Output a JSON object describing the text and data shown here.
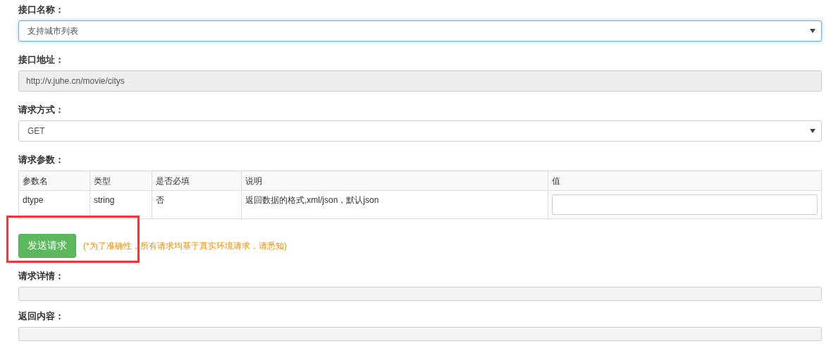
{
  "fields": [
    {
      "label": "接口名称：",
      "kind": "select",
      "value": "支持城市列表",
      "focused": true
    },
    {
      "label": "接口地址：",
      "kind": "readonly",
      "value": "http://v.juhe.cn/movie/citys"
    },
    {
      "label": "请求方式：",
      "kind": "select",
      "value": "GET",
      "focused": false
    }
  ],
  "params": {
    "label": "请求参数：",
    "columns": [
      "参数名",
      "类型",
      "是否必填",
      "说明",
      "值"
    ],
    "rows": [
      {
        "cells": [
          "dtype",
          "string",
          "否",
          "返回数据的格式,xml/json，默认json"
        ]
      }
    ]
  },
  "send_button": "发送请求",
  "notice": "(*为了准确性，所有请求均基于真实环境请求，请悉知)",
  "annotation": {
    "kind": "frame"
  },
  "outputs": [
    {
      "label": "请求详情："
    },
    {
      "label": "返回内容："
    }
  ]
}
